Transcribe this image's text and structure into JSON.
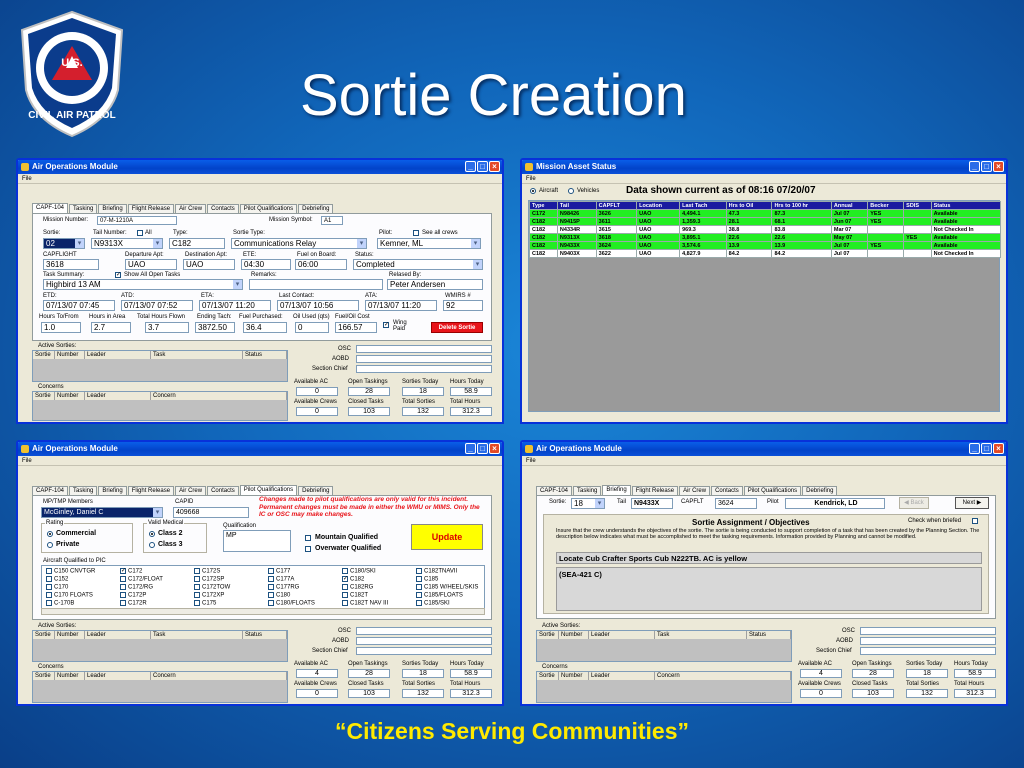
{
  "slide": {
    "title": "Sortie Creation",
    "slogan": "“Citizens Serving Communities”",
    "logo": {
      "top_text": "U.S.",
      "ring_text": "CIVIL AIR PATROL"
    }
  },
  "window_common": {
    "title": "Air Operations Module",
    "menu": "File",
    "tabs": [
      "CAPF-104",
      "Tasking",
      "Briefing",
      "Flight Release",
      "Air Crew",
      "Contacts",
      "Pilot Qualifications",
      "Debriefing"
    ]
  },
  "bottom_panel": {
    "active_sorties_label": "Active Sorties:",
    "active_sorties_cols": [
      "Sortie",
      "Number",
      "Leader",
      "Task",
      "Status"
    ],
    "concerns_label": "Concerns",
    "concerns_cols": [
      "Sortie",
      "Number",
      "Leader",
      "Concern"
    ],
    "osc_label": "OSC",
    "aobd_label": "AOBD",
    "section_chief_label": "Section Chief",
    "stats1": [
      {
        "label": "Available AC",
        "value": "0"
      },
      {
        "label": "Open Taskings",
        "value": "28"
      },
      {
        "label": "Sorties Today",
        "value": "18"
      },
      {
        "label": "Hours Today",
        "value": "58.9"
      }
    ],
    "stats1_ac4": "4",
    "stats2": [
      {
        "label": "Available Crews",
        "value": "0"
      },
      {
        "label": "Closed Tasks",
        "value": "103"
      },
      {
        "label": "Total Sorties",
        "value": "132"
      },
      {
        "label": "Total Hours",
        "value": "312.3"
      }
    ]
  },
  "win1": {
    "mission_number_label": "Mission Number:",
    "mission_number": "07-M-1210A",
    "mission_symbol_label": "Mission Symbol:",
    "mission_symbol": "A1",
    "sortie_label": "Sortie:",
    "sortie": "02",
    "tail_label": "Tail Number:",
    "all_label": "All",
    "tail": "N9313X",
    "type_label": "Type:",
    "type": "C182",
    "sortie_type_label": "Sortie Type:",
    "sortie_type": "Communications Relay",
    "pilot_label": "Pilot:",
    "see_all_crews": "See all crews",
    "pilot": "Kemner, ML",
    "capflight_label": "CAPFLIGHT",
    "capflight": "3618",
    "departure_label": "Departure Apt:",
    "departure": "UAO",
    "destination_label": "Destination Apt:",
    "destination": "UAO",
    "ete_label": "ETE:",
    "ete": "04:30",
    "fuel_on_board_label": "Fuel on Board:",
    "fuel_on_board": "06:00",
    "status_label": "Status:",
    "status": "Completed",
    "task_summary_label": "Task Summary:",
    "show_open_taskings": "Show All Open Tasks",
    "task_summary": "Highbird 13 AM",
    "remarks_label": "Remarks:",
    "relased_by_label": "Relased By:",
    "relased_by": "Peter Andersen",
    "etd_label": "ETD:",
    "etd": "07/13/07 07:45",
    "atd_label": "ATD:",
    "atd": "07/13/07 07:52",
    "eta_label": "ETA:",
    "eta": "07/13/07 11:20",
    "last_contact_label": "Last Contact:",
    "last_contact": "07/13/07 10:56",
    "ata_label": "ATA:",
    "ata": "07/13/07 11:20",
    "wmirs_label": "WMIRS #",
    "wmirs": "92",
    "hours_tofrom_label": "Hours To/From",
    "hours_tofrom": "1.0",
    "hours_in_area_label": "Hours in Area",
    "hours_in_area": "2.7",
    "total_hours_flown_label": "Total Hours Flown",
    "total_hours_flown": "3.7",
    "ending_tach_label": "Ending Tach:",
    "ending_tach": "3872.50",
    "fuel_purchased_label": "Fuel Purchased:",
    "fuel_purchased": "36.4",
    "oil_used_label": "Oil Used (qts)",
    "oil_used": "0",
    "fuel_oil_cost_label": "Fuel/Oil Cost",
    "fuel_oil_cost": "166.57",
    "wing_paid": "Wing Paid",
    "delete_sortie": "Delete Sortie"
  },
  "win2": {
    "title": "Mission Asset Status",
    "menu": "File",
    "radio_aircraft": "Aircraft",
    "radio_vehicles": "Vehicles",
    "headline": "Data shown current as of 08:16 07/20/07",
    "columns": [
      "Type",
      "Tail",
      "CAPFLT",
      "Location",
      "Last Tach",
      "Hrs to Oil",
      "Hrs to 100 hr",
      "Annual",
      "Becker",
      "SDIS",
      "Status"
    ],
    "rows": [
      {
        "color": "rg",
        "cells": [
          "C172",
          "N98426",
          "3626",
          "UAO",
          "4,494.1",
          "47.3",
          "87.3",
          "Jul 07",
          "YES",
          "",
          "Available"
        ]
      },
      {
        "color": "rg",
        "cells": [
          "C182",
          "N9415P",
          "3611",
          "UAO",
          "1,359.3",
          "28.1",
          "68.1",
          "Jun 07",
          "YES",
          "",
          "Available"
        ]
      },
      {
        "color": "rw",
        "cells": [
          "C182",
          "N4334R",
          "3615",
          "UAO",
          "969.3",
          "38.8",
          "83.8",
          "Mar 07",
          "",
          "",
          "Not Checked In"
        ]
      },
      {
        "color": "rg",
        "cells": [
          "C182",
          "N9313X",
          "3618",
          "UAO",
          "3,895.1",
          "22.6",
          "22.6",
          "May 07",
          "",
          "YES",
          "Available"
        ]
      },
      {
        "color": "rg",
        "cells": [
          "C182",
          "N9433X",
          "3624",
          "UAO",
          "3,574.6",
          "13.9",
          "13.9",
          "Jul 07",
          "YES",
          "",
          "Available"
        ]
      },
      {
        "color": "rw",
        "cells": [
          "C182",
          "N9403X",
          "3622",
          "UAO",
          "4,827.9",
          "84.2",
          "84.2",
          "Jul 07",
          "",
          "",
          "Not Checked In"
        ]
      }
    ]
  },
  "win3": {
    "mp_label": "MP/TMP Members",
    "mp_value": "McGinley, Daniel C",
    "capid_label": "CAPID",
    "capid": "409668",
    "warning": "Changes made to pilot qualifications are only valid for this incident. Permanent changes must be made in either the WMU or MIMS. Only the IC or OSC may make changes.",
    "rating_label": "Rating",
    "rating_commercial": "Commercial",
    "rating_private": "Private",
    "valid_medical_label": "Valid Medical",
    "class2": "Class 2",
    "class3": "Class 3",
    "qualification_label": "Qualification",
    "qualification": "MP",
    "mountain": "Mountain Qualified",
    "overwater": "Overwater Qualified",
    "update": "Update",
    "aircraft_qualified_label": "Aircraft Qualified to PIC",
    "aircraft_cols": [
      [
        {
          "t": "C150 CNVTGR",
          "c": false
        },
        {
          "t": "C152",
          "c": false
        },
        {
          "t": "C170",
          "c": false
        },
        {
          "t": "C170 FLOATS",
          "c": false
        },
        {
          "t": "C-170B",
          "c": false
        }
      ],
      [
        {
          "t": "C172",
          "c": true
        },
        {
          "t": "C172/FLOAT",
          "c": false
        },
        {
          "t": "C172/RG",
          "c": false
        },
        {
          "t": "C172P",
          "c": false
        },
        {
          "t": "C172R",
          "c": false
        }
      ],
      [
        {
          "t": "C172S",
          "c": false
        },
        {
          "t": "C172SP",
          "c": false
        },
        {
          "t": "C172TOW",
          "c": false
        },
        {
          "t": "C172XP",
          "c": false
        },
        {
          "t": "C175",
          "c": false
        }
      ],
      [
        {
          "t": "C177",
          "c": false
        },
        {
          "t": "C177A",
          "c": false
        },
        {
          "t": "C177RG",
          "c": false
        },
        {
          "t": "C180",
          "c": false
        },
        {
          "t": "C180/FLOATS",
          "c": false
        }
      ],
      [
        {
          "t": "C180/SKI",
          "c": false
        },
        {
          "t": "C182",
          "c": true
        },
        {
          "t": "C182RG",
          "c": false
        },
        {
          "t": "C182T",
          "c": false
        },
        {
          "t": "C182T NAV III",
          "c": false
        }
      ],
      [
        {
          "t": "C182TNAVII",
          "c": false
        },
        {
          "t": "C185",
          "c": false
        },
        {
          "t": "C185 W/HEEL/SKIS",
          "c": false
        },
        {
          "t": "C185/FLOATS",
          "c": false
        },
        {
          "t": "C185/SKI",
          "c": false
        }
      ]
    ]
  },
  "win4": {
    "sortie_label": "Sortie:",
    "sortie": "18",
    "tail_label": "Tail",
    "tail": "N9433X",
    "capflt_label": "CAPFLT",
    "capflt": "3624",
    "pilot_label": "Pilot",
    "pilot": "Kendrick, LD",
    "back": "Back",
    "next": "Next",
    "heading": "Sortie Assignment / Objectives",
    "check_briefed": "Check when briefed",
    "instructions": "Insure that the crew understands the objectives of the sortie. The sortie is being conducted to support completion of a task that has been created by the Planning Section. The description below indicates what must be accomplished to meet the tasking requirements. Information provided by Planning and cannot be modified.",
    "objective1": "Locate Cub Crafter Sports Cub N222TB. AC is yellow",
    "objective2": "(SEA-421 C)"
  }
}
